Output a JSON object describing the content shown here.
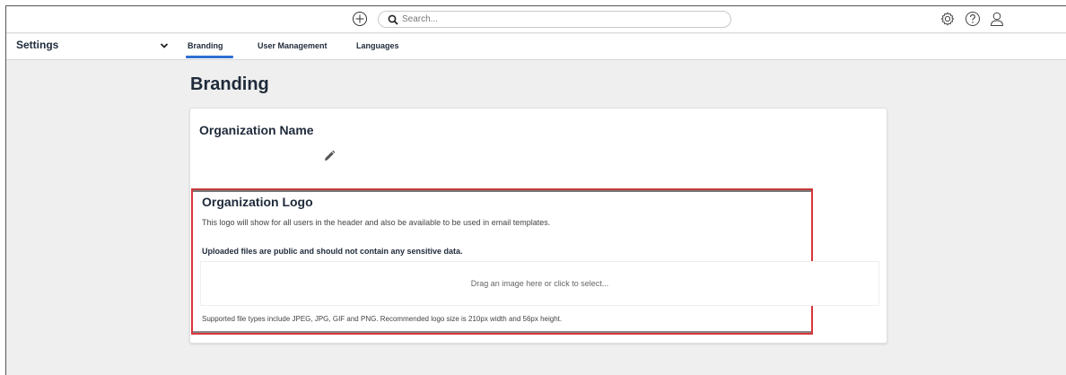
{
  "search": {
    "placeholder": "Search..."
  },
  "header": {
    "more_label": "•••"
  },
  "nav": {
    "section_title": "Settings",
    "tabs": [
      {
        "label": "Branding"
      },
      {
        "label": "User Management"
      },
      {
        "label": "Languages"
      }
    ]
  },
  "page": {
    "title": "Branding",
    "org_name": {
      "heading": "Organization Name"
    },
    "org_logo": {
      "heading": "Organization Logo",
      "description": "This logo will show for all users in the header and also be available to be used in email templates.",
      "warning": "Uploaded files are public and should not contain any sensitive data.",
      "dropzone_text": "Drag an image here or click to select...",
      "supported": "Supported file types include JPEG, JPG, GIF and PNG. Recommended logo size is 210px width and 56px height."
    }
  },
  "colors": {
    "accent": "#2f6fd3",
    "highlight": "#d8343a"
  },
  "icons": [
    "plus-circle-icon",
    "search-icon",
    "gear-icon",
    "help-icon",
    "user-icon",
    "chevron-down-icon",
    "pencil-icon"
  ]
}
